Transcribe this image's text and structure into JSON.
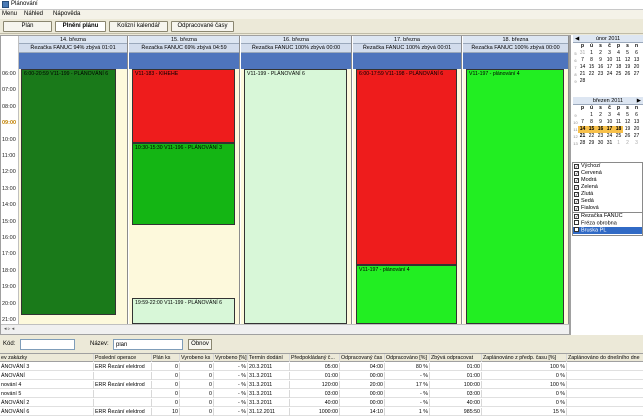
{
  "window": {
    "title": "Plánování"
  },
  "menu": [
    "Menu",
    "Náhled",
    "Nápověda"
  ],
  "toolbar": {
    "buttons": [
      "Plán",
      "Plnění plánu",
      "Kolizní kalendář",
      "Odpracované časy"
    ],
    "active": "Plnění plánu"
  },
  "planner": {
    "times": [
      "06:00",
      "07:00",
      "08:00",
      "09:00",
      "10:00",
      "11:00",
      "12:00",
      "13:00",
      "14:00",
      "15:00",
      "16:00",
      "17:00",
      "18:00",
      "19:00",
      "20:00",
      "21:00"
    ],
    "current_time": "09:00",
    "days": [
      {
        "header": "14. března",
        "sub": "Řezačka FANUC 94% zbývá 01:01"
      },
      {
        "header": "15. března",
        "sub": "Řezačka FANUC 69% zbývá 04:59"
      },
      {
        "header": "16. března",
        "sub": "Řezačka FANUC 100% zbývá 00:00"
      },
      {
        "header": "17. března",
        "sub": "Řezačka FANUC 100% zbývá 00:01"
      },
      {
        "header": "18. března",
        "sub": "Řezačka FANUC 100% zbývá 00:00"
      }
    ],
    "events": [
      {
        "day": 0,
        "text": "6:00-20:59 V11-199 - PLÁNOVÁNÍ 6",
        "color": "#1a7a1a",
        "start": 6.0,
        "end": 20.98
      },
      {
        "day": 1,
        "text": "V11-183 - KIHEHE",
        "color": "#ee1c1c",
        "start": 6.0,
        "end": 10.5
      },
      {
        "day": 1,
        "text": "10:30-15:30 V11-196 - PLÁNOVÁNÍ 3",
        "color": "#14b514",
        "start": 10.5,
        "end": 15.5
      },
      {
        "day": 1,
        "text": "19:59-22:00 V11-199 - PLÁNOVÁNÍ 6",
        "color": "#d8f7d8",
        "start": 19.98,
        "end": 22.0
      },
      {
        "day": 2,
        "text": "V11-199 - PLÁNOVÁNÍ 6",
        "color": "#d8f7d8",
        "start": 6.0,
        "end": 22.0
      },
      {
        "day": 3,
        "text": "6:00-17:59 V11-198 - PLÁNOVÁNÍ 6",
        "color": "#ee1c1c",
        "start": 6.0,
        "end": 17.98
      },
      {
        "day": 3,
        "text": "V11-197 - plánování 4",
        "color": "#22ee22",
        "start": 17.98,
        "end": 22.0
      },
      {
        "day": 4,
        "text": "V11-197 - plánování 4",
        "color": "#22ee22",
        "start": 6.0,
        "end": 22.0
      }
    ]
  },
  "calendars": [
    {
      "title": "únor 2011",
      "weekdays": [
        "p",
        "ú",
        "s",
        "č",
        "p",
        "s",
        "n"
      ],
      "rows": [
        {
          "wk": "5",
          "days": [
            [
              "31",
              "gray"
            ],
            [
              "1",
              ""
            ],
            [
              "2",
              ""
            ],
            [
              "3",
              ""
            ],
            [
              "4",
              ""
            ],
            [
              "5",
              ""
            ],
            [
              "6",
              ""
            ]
          ]
        },
        {
          "wk": "6",
          "days": [
            [
              "7",
              ""
            ],
            [
              "8",
              ""
            ],
            [
              "9",
              ""
            ],
            [
              "10",
              ""
            ],
            [
              "11",
              ""
            ],
            [
              "12",
              ""
            ],
            [
              "13",
              ""
            ]
          ]
        },
        {
          "wk": "7",
          "days": [
            [
              "14",
              ""
            ],
            [
              "15",
              ""
            ],
            [
              "16",
              ""
            ],
            [
              "17",
              ""
            ],
            [
              "18",
              ""
            ],
            [
              "19",
              ""
            ],
            [
              "20",
              ""
            ]
          ]
        },
        {
          "wk": "8",
          "days": [
            [
              "21",
              ""
            ],
            [
              "22",
              ""
            ],
            [
              "23",
              ""
            ],
            [
              "24",
              ""
            ],
            [
              "25",
              ""
            ],
            [
              "26",
              ""
            ],
            [
              "27",
              ""
            ]
          ]
        },
        {
          "wk": "9",
          "days": [
            [
              "28",
              ""
            ],
            [
              "",
              ""
            ],
            [
              "",
              ""
            ],
            [
              "",
              ""
            ],
            [
              "",
              ""
            ],
            [
              "",
              ""
            ],
            [
              "",
              ""
            ]
          ]
        }
      ]
    },
    {
      "title": "březen 2011",
      "weekdays": [
        "p",
        "ú",
        "s",
        "č",
        "p",
        "s",
        "n"
      ],
      "rows": [
        {
          "wk": "9",
          "days": [
            [
              "",
              ""
            ],
            [
              "1",
              ""
            ],
            [
              "2",
              ""
            ],
            [
              "3",
              ""
            ],
            [
              "4",
              ""
            ],
            [
              "5",
              ""
            ],
            [
              "6",
              ""
            ]
          ]
        },
        {
          "wk": "10",
          "days": [
            [
              "7",
              ""
            ],
            [
              "8",
              ""
            ],
            [
              "9",
              ""
            ],
            [
              "10",
              ""
            ],
            [
              "11",
              ""
            ],
            [
              "12",
              ""
            ],
            [
              "13",
              ""
            ]
          ]
        },
        {
          "wk": "11",
          "days": [
            [
              "14",
              "sel"
            ],
            [
              "15",
              "sel"
            ],
            [
              "16",
              "sel"
            ],
            [
              "17",
              "sel"
            ],
            [
              "18",
              "sel"
            ],
            [
              "19",
              ""
            ],
            [
              "20",
              ""
            ]
          ]
        },
        {
          "wk": "12",
          "days": [
            [
              "21",
              "bold"
            ],
            [
              "22",
              ""
            ],
            [
              "23",
              ""
            ],
            [
              "24",
              ""
            ],
            [
              "25",
              ""
            ],
            [
              "26",
              ""
            ],
            [
              "27",
              ""
            ]
          ]
        },
        {
          "wk": "13",
          "days": [
            [
              "28",
              ""
            ],
            [
              "29",
              ""
            ],
            [
              "30",
              ""
            ],
            [
              "31",
              ""
            ],
            [
              "1",
              "gray"
            ],
            [
              "2",
              "gray"
            ],
            [
              "3",
              "gray"
            ]
          ]
        }
      ]
    }
  ],
  "colors": [
    "Výchozí",
    "Červená",
    "Modrá",
    "Zelená",
    "Žlutá",
    "Šedá",
    "Fialová"
  ],
  "machines": [
    {
      "label": "Řezačka FANUC",
      "checked": true,
      "selected": false
    },
    {
      "label": "Fréza obrobna",
      "checked": false,
      "selected": false
    },
    {
      "label": "Bruska PL",
      "checked": false,
      "selected": true
    }
  ],
  "filter": {
    "kod_label": "Kód:",
    "kod_value": "",
    "nazev_label": "Název:",
    "nazev_value": "plán",
    "refresh": "Obnov"
  },
  "grid": {
    "columns": [
      "ev zakázky",
      "Poslední operace",
      "Plán ks",
      "Vyrobeno ks",
      "Vyrobeno [%]",
      "Termín dodání",
      "Předpokládaný č...",
      "Odpracovaný čas",
      "Odpracováno [%]",
      "Zbývá odpracovat",
      "Zaplánováno z předp. času [%]",
      "Zaplánováno do dnešního dne"
    ],
    "rows": [
      [
        "ÁNOVÁNÍ 3",
        "ERR Řezání elektrod",
        "0",
        "0",
        "- %",
        "20.3.2011",
        "05:00",
        "04:00",
        "80 %",
        "01:00",
        "100 %",
        ""
      ],
      [
        "ÁNOVÁNÍ",
        "",
        "0",
        "0",
        "- %",
        "31.3.2011",
        "01:00",
        "00:00",
        "- %",
        "01:00",
        "0 %",
        ""
      ],
      [
        "nování 4",
        "ERR Řezání elektrod",
        "0",
        "0",
        "- %",
        "31.3.2011",
        "120:00",
        "20:00",
        "17 %",
        "100:00",
        "100 %",
        ""
      ],
      [
        "nování 5",
        "",
        "0",
        "0",
        "- %",
        "31.3.2011",
        "03:00",
        "00:00",
        "- %",
        "03:00",
        "0 %",
        ""
      ],
      [
        "ÁNOVÁNÍ 2",
        "",
        "0",
        "0",
        "- %",
        "31.3.2011",
        "40:00",
        "00:00",
        "- %",
        "40:00",
        "0 %",
        ""
      ],
      [
        "ÁNOVÁNÍ 6",
        "ERR Řezání elektrod",
        "10",
        "0",
        "- %",
        "31.12.2011",
        "1000:00",
        "14:10",
        "1 %",
        "985:50",
        "15 %",
        ""
      ]
    ]
  }
}
